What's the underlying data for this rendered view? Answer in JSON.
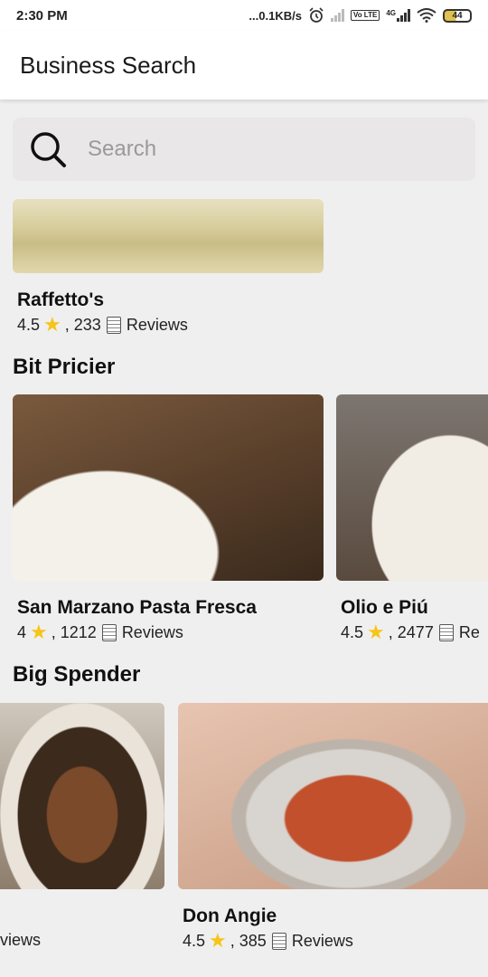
{
  "status_bar": {
    "time": "2:30 PM",
    "network_speed": "...0.1KB/s",
    "network_type": "4G",
    "volte": "Vo LTE",
    "battery": "44",
    "icons": [
      "alarm-icon",
      "signal-icon",
      "volte-icon",
      "signal-4g-icon",
      "wifi-icon",
      "battery-icon"
    ]
  },
  "app_bar": {
    "title": "Business Search"
  },
  "search": {
    "placeholder": "Search",
    "value": ""
  },
  "sections": [
    {
      "title": "",
      "cards": [
        {
          "name": "Raffetto's",
          "rating": "4.5",
          "review_count": "233",
          "reviews_label": "Reviews"
        }
      ]
    },
    {
      "title": "Bit Pricier",
      "cards": [
        {
          "name": "San Marzano Pasta Fresca",
          "rating": "4",
          "review_count": "1212",
          "reviews_label": "Reviews"
        },
        {
          "name": "Olio e Piú",
          "rating": "4.5",
          "review_count": "2477",
          "reviews_label": "Re"
        }
      ]
    },
    {
      "title": "Big Spender",
      "cards": [
        {
          "name": "",
          "rating": "",
          "review_count": "",
          "reviews_label": "views"
        },
        {
          "name": "Don Angie",
          "rating": "4.5",
          "review_count": "385",
          "reviews_label": "Reviews"
        }
      ]
    }
  ],
  "colors": {
    "background": "#f0efef",
    "app_bar": "#ffffff",
    "search_bg": "#e9e7e7",
    "star": "#f5c518",
    "text": "#111111"
  }
}
